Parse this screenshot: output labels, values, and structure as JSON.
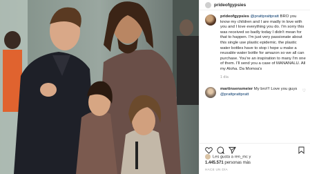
{
  "header": {
    "handle": "prideofgypsies"
  },
  "caption": {
    "username": "prideofgypsies",
    "mention": "@prattprattpratt",
    "text": "BRO you know my children and I are madly in love with you and I love everything you do. I'm sorry this was received so badly today I didn't mean for that to happen. I'm just very passionate about this single use plastic epidemic. the plastic water bottles have to stop i hope u make a reusable water bottle for amazon so we all can purchase. You're an inspiration to many I'm one of them. I'll send you a case of MANANALU. All my Aloha. Da Momoa's",
    "time": "1 día"
  },
  "reply": {
    "username": "martinsensmeier",
    "text_before": "My bro!!!",
    "text_after": "Love you guys",
    "mention": "@prattprattpratt"
  },
  "icons": [
    "heart-icon",
    "comment-icon",
    "share-icon",
    "bookmark-icon"
  ],
  "likes": {
    "prefix": "Les gusta a",
    "user": "ren_mc y",
    "count": "1.445.571",
    "suffix": "personas más"
  },
  "date": "HACE UN DÍA"
}
